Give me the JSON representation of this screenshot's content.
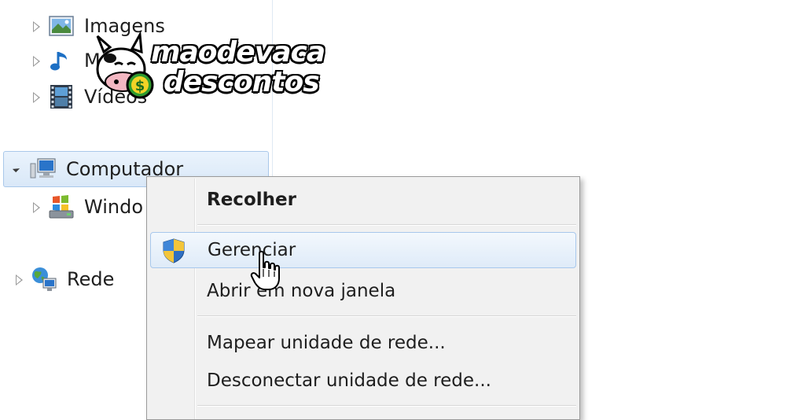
{
  "nav": {
    "items": [
      {
        "label": "Imagens",
        "icon": "pictures-library-icon"
      },
      {
        "label": "M",
        "icon": "music-library-icon"
      },
      {
        "label": "Vídeos",
        "icon": "videos-library-icon"
      },
      {
        "label": "Computador",
        "icon": "computer-icon"
      },
      {
        "label": "Windo",
        "icon": "windows-drive-icon"
      },
      {
        "label": "Rede",
        "icon": "network-icon"
      }
    ]
  },
  "context_menu": {
    "items": [
      {
        "label": "Recolher"
      },
      {
        "label": "Gerenciar",
        "icon": "uac-shield-icon"
      },
      {
        "label": "Abrir em nova janela"
      },
      {
        "label": "Mapear unidade de rede..."
      },
      {
        "label": "Desconectar unidade de rede..."
      }
    ]
  },
  "watermark": {
    "line1": "maodevaca",
    "line2": "descontos"
  },
  "colors": {
    "selection": "#d9e8f8",
    "selection_border": "#a9c8ea",
    "menu_bg": "#f1f1f1"
  }
}
